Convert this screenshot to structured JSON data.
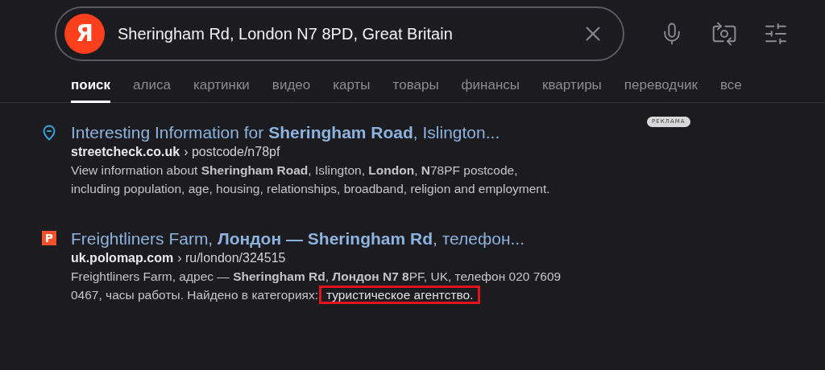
{
  "search": {
    "logo": "Я",
    "value": "Sheringham Rd, London N7 8PD, Great Britain"
  },
  "tabs": [
    {
      "label": "поиск",
      "selected": true
    },
    {
      "label": "алиса",
      "selected": false
    },
    {
      "label": "картинки",
      "selected": false
    },
    {
      "label": "видео",
      "selected": false
    },
    {
      "label": "карты",
      "selected": false
    },
    {
      "label": "товары",
      "selected": false
    },
    {
      "label": "финансы",
      "selected": false
    },
    {
      "label": "квартиры",
      "selected": false
    },
    {
      "label": "переводчик",
      "selected": false
    },
    {
      "label": "все",
      "selected": false
    }
  ],
  "ad_badge": "РЕКЛАМА",
  "results": [
    {
      "kind": "pin",
      "title": "Interesting Information for **Sheringham Road**, Islington...",
      "domain": "streetcheck.co.uk",
      "path": "› postcode/n78pf",
      "snippet": "View information about **Sheringham Road**, Islington, **London**, **N**78PF postcode, including population, age, housing, relationships, broadband, religion and employment."
    },
    {
      "kind": "letter",
      "icon_text": "P",
      "title": "Freightliners Farm, **Лондон — Sheringham Rd**, телефон...",
      "domain": "uk.polomap.com",
      "path": "› ru/london/324515",
      "snippet": "Freightliners Farm, адрес — **Sheringham Rd**, **Лондон N7 8**PF, UK, телефон 020 7609 0467, часы работы. Найдено в категориях:",
      "highlighted": "туристическое агентство."
    }
  ]
}
